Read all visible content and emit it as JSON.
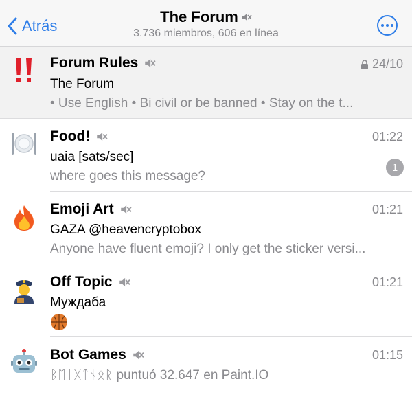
{
  "header": {
    "back_label": "Atrás",
    "title": "The Forum",
    "subtitle": "3.736 miembros, 606 en línea",
    "back_icon": "chevron-left-icon",
    "more_icon": "ellipsis-circle-icon",
    "accent_color": "#2f7ee8"
  },
  "topics": [
    {
      "title": "Forum Rules",
      "time": "24/10",
      "sender": "The Forum",
      "preview": "• Use English • Bi civil or be banned • Stay on the t...",
      "icon": "double-exclamation-icon",
      "muted": true,
      "locked": true,
      "pinned": true
    },
    {
      "title": "Food!",
      "time": "01:22",
      "sender": "uaia [sats/sec]",
      "preview": "where goes this message?",
      "unread": "1",
      "icon": "plate-fork-knife-icon",
      "muted": true
    },
    {
      "title": "Emoji Art",
      "time": "01:21",
      "sender": "GAZA @heavencryptobox",
      "preview": "Anyone have fluent emoji? I only get the sticker versi...",
      "icon": "fire-icon",
      "muted": true
    },
    {
      "title": "Off Topic",
      "time": "01:21",
      "sender": "Муждаба",
      "preview": "",
      "preview_icon": "basketball-icon",
      "icon": "police-officer-icon",
      "muted": true
    },
    {
      "title": "Bot Games",
      "time": "01:15",
      "sender": "",
      "preview": "ᛒᛖᛁᚷᛏᚾᛟᚱ puntuó 32.647 en Paint.IO",
      "icon": "robot-icon",
      "muted": true
    }
  ]
}
